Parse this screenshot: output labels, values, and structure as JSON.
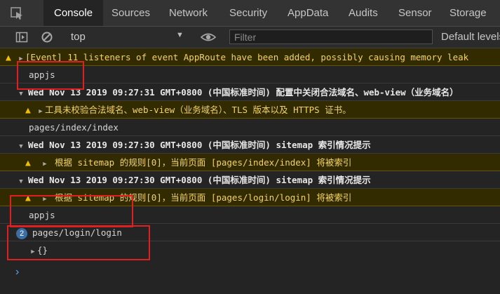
{
  "tabs": [
    "Console",
    "Sources",
    "Network",
    "Security",
    "AppData",
    "Audits",
    "Sensor",
    "Storage"
  ],
  "toolbar": {
    "context": "top",
    "filter_placeholder": "Filter",
    "levels": "Default levels"
  },
  "log": {
    "r0": "[Event] 11 listeners of event AppRoute have been added, possibly causing memory leak",
    "r1": "appjs",
    "r2": "Wed Nov 13 2019 09:27:31 GMT+0800 (中国标准时间) 配置中关闭合法域名、web-view（业务域名）",
    "r3": "工具未校验合法域名、web-view（业务域名）、TLS 版本以及 HTTPS 证书。",
    "r4": "pages/index/index",
    "r5": "Wed Nov 13 2019 09:27:30 GMT+0800 (中国标准时间) sitemap 索引情况提示",
    "r6": "根据 sitemap 的规则[0]，当前页面 [pages/index/index] 将被索引",
    "r7": "Wed Nov 13 2019 09:27:30 GMT+0800 (中国标准时间) sitemap 索引情况提示",
    "r8": "根据 sitemap 的规则[0]，当前页面 [pages/login/login] 将被索引",
    "r9": "appjs",
    "r10_badge": "2",
    "r10": "pages/login/login",
    "r11": "{}"
  },
  "prompt": "›",
  "colors": {
    "warning_bg": "#332b00",
    "warning_text": "#f2d26a",
    "highlight": "#e02020"
  }
}
